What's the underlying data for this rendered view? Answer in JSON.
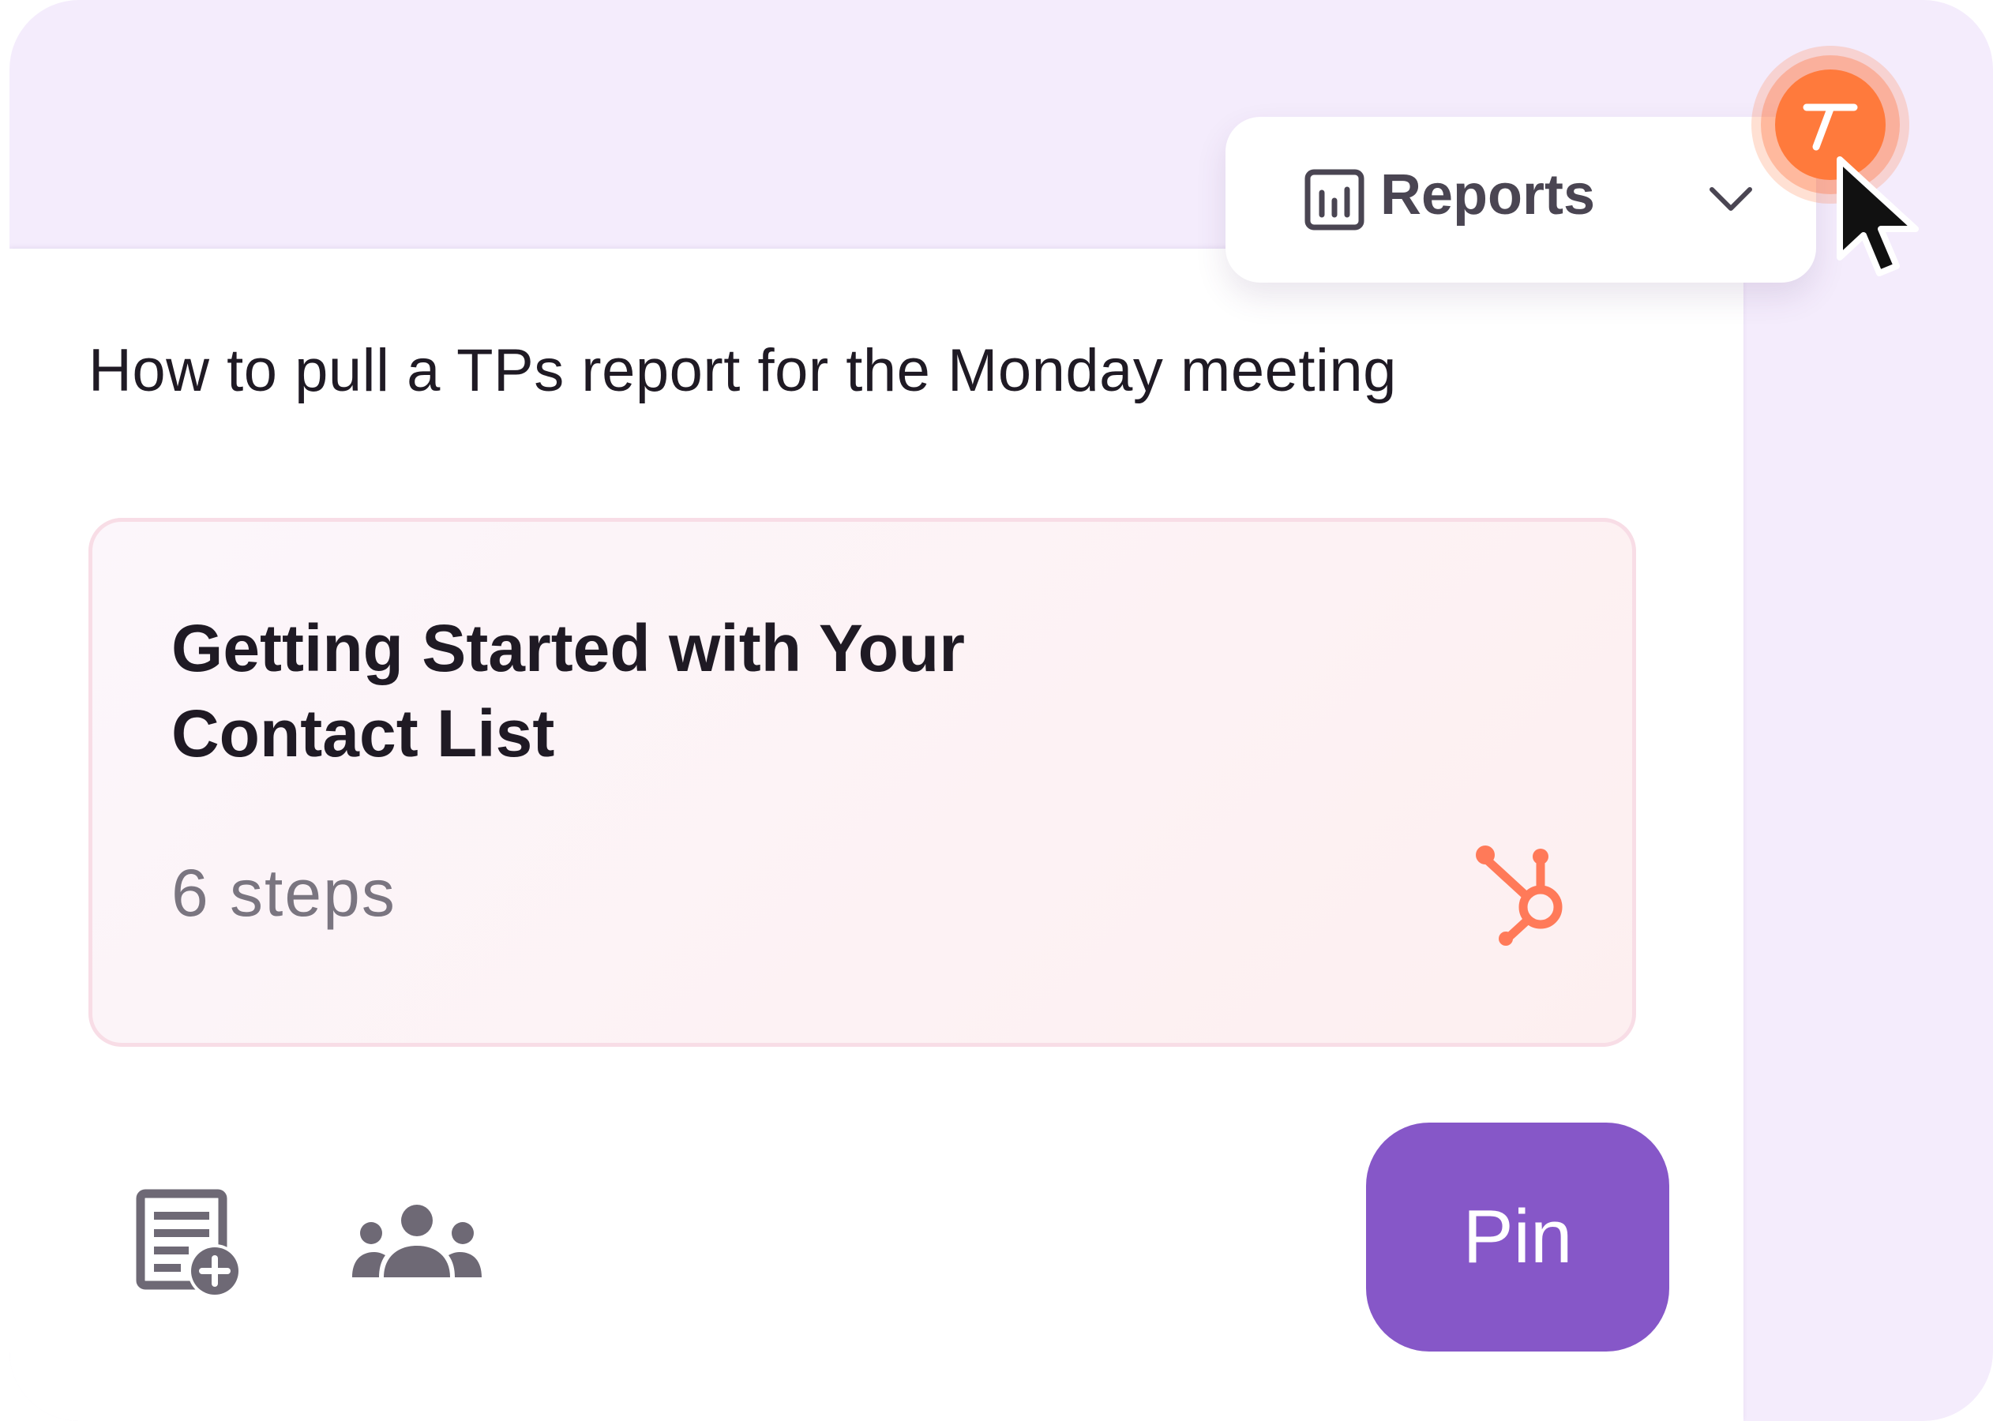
{
  "header": {
    "dropdown": {
      "icon": "bar-chart-icon",
      "label": "Reports",
      "chevron": "chevron-down-icon"
    },
    "avatar": {
      "icon": "t-logo-icon",
      "color": "#ff7a3c"
    }
  },
  "main": {
    "question": "How to pull a TPs report for the Monday meeting",
    "guide_card": {
      "title": "Getting Started with Your Contact List",
      "steps": "6 steps",
      "integration_icon": "hubspot-icon",
      "integration_color": "#ff7a59"
    },
    "actions": {
      "add_doc_icon": "add-document-icon",
      "team_icon": "team-icon",
      "pin_label": "Pin",
      "pin_color": "#8657c8"
    }
  },
  "colors": {
    "background": "#f4ecfc",
    "panel": "#ffffff",
    "text": "#1f1a24",
    "muted_text": "#7a7580"
  }
}
